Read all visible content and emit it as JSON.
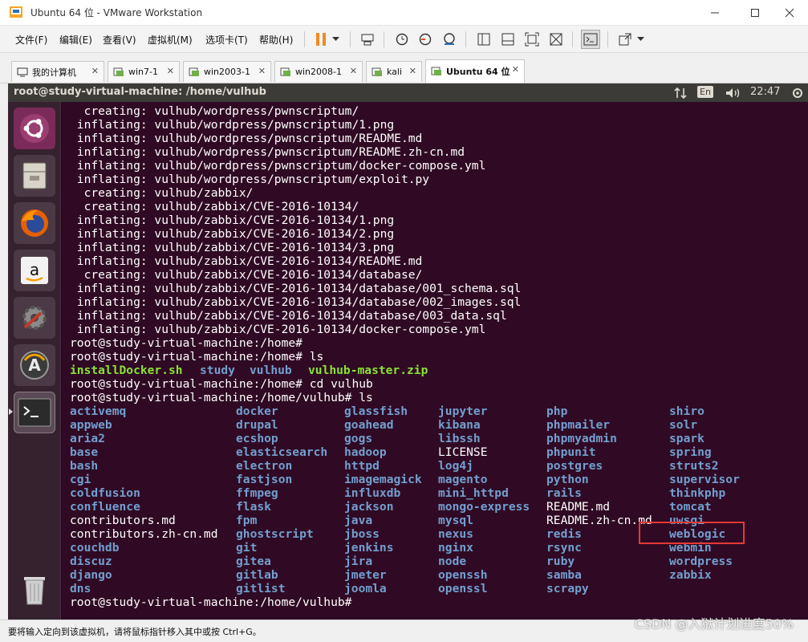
{
  "window": {
    "title": "Ubuntu 64 位 - VMware Workstation",
    "controls": [
      "—",
      "☐",
      "✕"
    ]
  },
  "menu": {
    "file": "文件(F)",
    "edit": "编辑(E)",
    "view": "查看(V)",
    "vm": "虚拟机(M)",
    "tabs": "选项卡(T)",
    "help": "帮助(H)"
  },
  "vm_tabs": [
    {
      "label": "我的计算机",
      "icon": "computer-icon"
    },
    {
      "label": "win7-1",
      "icon": "vm-icon"
    },
    {
      "label": "win2003-1",
      "icon": "vm-icon"
    },
    {
      "label": "win2008-1",
      "icon": "vm-icon"
    },
    {
      "label": "kali",
      "icon": "vm-icon"
    },
    {
      "label": "Ubuntu 64 位",
      "icon": "vm-icon",
      "active": true
    }
  ],
  "ubuntu_panel": {
    "window_title": "root@study-virtual-machine: /home/vulhub",
    "keyboard": "En",
    "time": "22:47"
  },
  "terminal_lines": [
    "  creating: vulhub/wordpress/pwnscriptum/",
    " inflating: vulhub/wordpress/pwnscriptum/1.png",
    " inflating: vulhub/wordpress/pwnscriptum/README.md",
    " inflating: vulhub/wordpress/pwnscriptum/README.zh-cn.md",
    " inflating: vulhub/wordpress/pwnscriptum/docker-compose.yml",
    " inflating: vulhub/wordpress/pwnscriptum/exploit.py",
    "  creating: vulhub/zabbix/",
    "  creating: vulhub/zabbix/CVE-2016-10134/",
    " inflating: vulhub/zabbix/CVE-2016-10134/1.png",
    " inflating: vulhub/zabbix/CVE-2016-10134/2.png",
    " inflating: vulhub/zabbix/CVE-2016-10134/3.png",
    " inflating: vulhub/zabbix/CVE-2016-10134/README.md",
    "  creating: vulhub/zabbix/CVE-2016-10134/database/",
    " inflating: vulhub/zabbix/CVE-2016-10134/database/001_schema.sql",
    " inflating: vulhub/zabbix/CVE-2016-10134/database/002_images.sql",
    " inflating: vulhub/zabbix/CVE-2016-10134/database/003_data.sql",
    " inflating: vulhub/zabbix/CVE-2016-10134/docker-compose.yml",
    "root@study-virtual-machine:/home#",
    "root@study-virtual-machine:/home# ls"
  ],
  "ls_home": [
    {
      "name": "installDocker.sh",
      "type": "exec"
    },
    {
      "name": "study",
      "type": "dir"
    },
    {
      "name": "vulhub",
      "type": "dir"
    },
    {
      "name": "vulhub-master.zip",
      "type": "exec"
    }
  ],
  "after_ls_lines": [
    "root@study-virtual-machine:/home# cd vulhub",
    "root@study-virtual-machine:/home/vulhub# ls"
  ],
  "ls_vulhub_columns": [
    [
      {
        "name": "activemq",
        "type": "dir"
      },
      {
        "name": "appweb",
        "type": "dir"
      },
      {
        "name": "aria2",
        "type": "dir"
      },
      {
        "name": "base",
        "type": "dir"
      },
      {
        "name": "bash",
        "type": "dir"
      },
      {
        "name": "cgi",
        "type": "dir"
      },
      {
        "name": "coldfusion",
        "type": "dir"
      },
      {
        "name": "confluence",
        "type": "dir"
      },
      {
        "name": "contributors.md",
        "type": "file"
      },
      {
        "name": "contributors.zh-cn.md",
        "type": "file"
      },
      {
        "name": "couchdb",
        "type": "dir"
      },
      {
        "name": "discuz",
        "type": "dir"
      },
      {
        "name": "django",
        "type": "dir"
      },
      {
        "name": "dns",
        "type": "dir"
      }
    ],
    [
      {
        "name": "docker",
        "type": "dir"
      },
      {
        "name": "drupal",
        "type": "dir"
      },
      {
        "name": "ecshop",
        "type": "dir"
      },
      {
        "name": "elasticsearch",
        "type": "dir"
      },
      {
        "name": "electron",
        "type": "dir"
      },
      {
        "name": "fastjson",
        "type": "dir"
      },
      {
        "name": "ffmpeg",
        "type": "dir"
      },
      {
        "name": "flask",
        "type": "dir"
      },
      {
        "name": "fpm",
        "type": "dir"
      },
      {
        "name": "ghostscript",
        "type": "dir"
      },
      {
        "name": "git",
        "type": "dir"
      },
      {
        "name": "gitea",
        "type": "dir"
      },
      {
        "name": "gitlab",
        "type": "dir"
      },
      {
        "name": "gitlist",
        "type": "dir"
      }
    ],
    [
      {
        "name": "glassfish",
        "type": "dir"
      },
      {
        "name": "goahead",
        "type": "dir"
      },
      {
        "name": "gogs",
        "type": "dir"
      },
      {
        "name": "hadoop",
        "type": "dir"
      },
      {
        "name": "httpd",
        "type": "dir"
      },
      {
        "name": "imagemagick",
        "type": "dir"
      },
      {
        "name": "influxdb",
        "type": "dir"
      },
      {
        "name": "jackson",
        "type": "dir"
      },
      {
        "name": "java",
        "type": "dir"
      },
      {
        "name": "jboss",
        "type": "dir"
      },
      {
        "name": "jenkins",
        "type": "dir"
      },
      {
        "name": "jira",
        "type": "dir"
      },
      {
        "name": "jmeter",
        "type": "dir"
      },
      {
        "name": "joomla",
        "type": "dir"
      }
    ],
    [
      {
        "name": "jupyter",
        "type": "dir"
      },
      {
        "name": "kibana",
        "type": "dir"
      },
      {
        "name": "libssh",
        "type": "dir"
      },
      {
        "name": "LICENSE",
        "type": "file"
      },
      {
        "name": "log4j",
        "type": "dir"
      },
      {
        "name": "magento",
        "type": "dir"
      },
      {
        "name": "mini_httpd",
        "type": "dir"
      },
      {
        "name": "mongo-express",
        "type": "dir"
      },
      {
        "name": "mysql",
        "type": "dir"
      },
      {
        "name": "nexus",
        "type": "dir"
      },
      {
        "name": "nginx",
        "type": "dir"
      },
      {
        "name": "node",
        "type": "dir"
      },
      {
        "name": "openssh",
        "type": "dir"
      },
      {
        "name": "openssl",
        "type": "dir"
      }
    ],
    [
      {
        "name": "php",
        "type": "dir"
      },
      {
        "name": "phpmailer",
        "type": "dir"
      },
      {
        "name": "phpmyadmin",
        "type": "dir"
      },
      {
        "name": "phpunit",
        "type": "dir"
      },
      {
        "name": "postgres",
        "type": "dir"
      },
      {
        "name": "python",
        "type": "dir"
      },
      {
        "name": "rails",
        "type": "dir"
      },
      {
        "name": "README.md",
        "type": "file"
      },
      {
        "name": "README.zh-cn.md",
        "type": "file"
      },
      {
        "name": "redis",
        "type": "dir"
      },
      {
        "name": "rsync",
        "type": "dir"
      },
      {
        "name": "ruby",
        "type": "dir"
      },
      {
        "name": "samba",
        "type": "dir"
      },
      {
        "name": "scrapy",
        "type": "dir"
      }
    ],
    [
      {
        "name": "shiro",
        "type": "dir"
      },
      {
        "name": "solr",
        "type": "dir"
      },
      {
        "name": "spark",
        "type": "dir"
      },
      {
        "name": "spring",
        "type": "dir"
      },
      {
        "name": "struts2",
        "type": "dir"
      },
      {
        "name": "supervisor",
        "type": "dir"
      },
      {
        "name": "thinkphp",
        "type": "dir"
      },
      {
        "name": "tomcat",
        "type": "dir"
      },
      {
        "name": "uwsgi",
        "type": "dir"
      },
      {
        "name": "weblogic",
        "type": "dir"
      },
      {
        "name": "webmin",
        "type": "dir"
      },
      {
        "name": "wordpress",
        "type": "dir"
      },
      {
        "name": "zabbix",
        "type": "dir"
      }
    ]
  ],
  "final_prompt": "root@study-virtual-machine:/home/vulhub#",
  "statusbar": {
    "message": "要将输入定向到该虚拟机，请将鼠标指针移入其中或按 Ctrl+G。"
  },
  "watermark": "CSDN @入狱计划进度50%",
  "colors": {
    "terminal_bg": "#300a24",
    "dir": "#729fcf",
    "exec": "#8ae234",
    "highlight": "#e53935"
  }
}
